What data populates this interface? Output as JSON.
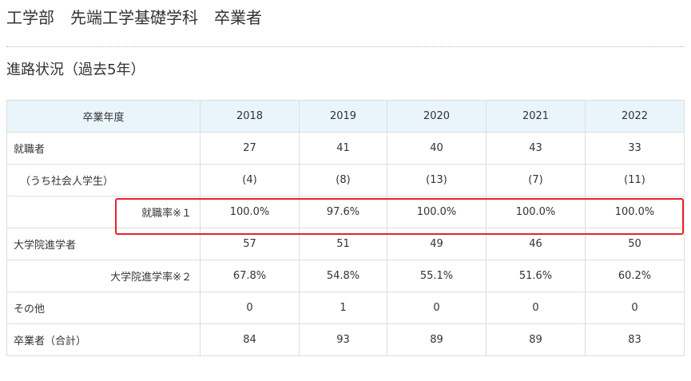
{
  "page": {
    "title": "工学部　先端工学基礎学科　卒業者",
    "section_title": "進路状況（過去5年）"
  },
  "table": {
    "header": {
      "label": "卒業年度",
      "years": [
        "2018",
        "2019",
        "2020",
        "2021",
        "2022"
      ]
    },
    "rows": [
      {
        "label": "就職者",
        "values": [
          "27",
          "41",
          "40",
          "43",
          "33"
        ]
      },
      {
        "label": "（うち社会人学生）",
        "values": [
          "(4)",
          "(8)",
          "(13)",
          "(7)",
          "(11)"
        ]
      },
      {
        "label": "就職率※１",
        "values": [
          "100.0%",
          "97.6%",
          "100.0%",
          "100.0%",
          "100.0%"
        ]
      },
      {
        "label": "大学院進学者",
        "values": [
          "57",
          "51",
          "49",
          "46",
          "50"
        ]
      },
      {
        "label": "大学院進学率※２",
        "values": [
          "67.8%",
          "54.8%",
          "55.1%",
          "51.6%",
          "60.2%"
        ]
      },
      {
        "label": "その他",
        "values": [
          "0",
          "1",
          "0",
          "0",
          "0"
        ]
      },
      {
        "label": "卒業者（合計）",
        "values": [
          "84",
          "93",
          "89",
          "89",
          "83"
        ]
      }
    ]
  },
  "colors": {
    "header_bg": "#e9f5fb",
    "border": "#dddddd",
    "highlight": "#e8232a",
    "text": "#333333"
  }
}
